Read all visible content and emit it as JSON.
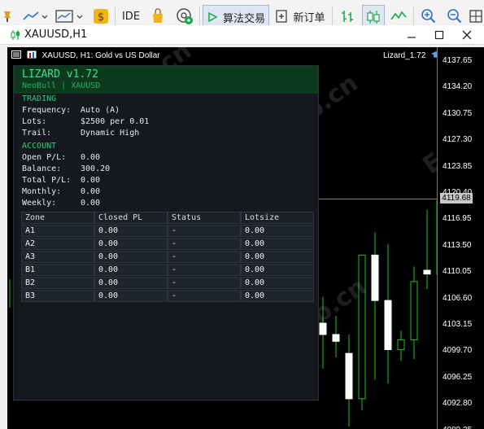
{
  "toolbar": {
    "ide_label": "IDE",
    "algo_trading_label": "算法交易",
    "new_order_label": "新订单"
  },
  "window": {
    "title": "XAUUSD,H1"
  },
  "chart": {
    "header": "XAUUSD, H1:  Gold vs US Dollar",
    "indicator_label": "Lizard_1.72",
    "current_price": "4119.68",
    "axis_ticks": [
      "4137.65",
      "4134.20",
      "4130.75",
      "4127.30",
      "4123.85",
      "4120.40",
      "4116.95",
      "4113.50",
      "4110.05",
      "4106.60",
      "4103.15",
      "4099.70",
      "4096.25",
      "4092.80",
      "4089.35"
    ]
  },
  "panel": {
    "title": "LIZARD v1.72",
    "subtitle": "NeoBull  |  XAUUSD",
    "trading_header": "TRADING",
    "trading": [
      {
        "k": "Frequency:",
        "v": "Auto (A)"
      },
      {
        "k": "Lots:",
        "v": "$2500 per 0.01"
      },
      {
        "k": "Trail:",
        "v": "Dynamic High"
      }
    ],
    "account_header": "ACCOUNT",
    "account": [
      {
        "k": "Open P/L:",
        "v": "0.00"
      },
      {
        "k": "Balance:",
        "v": "300.20"
      },
      {
        "k": "Total P/L:",
        "v": "0.00"
      },
      {
        "k": "Monthly:",
        "v": "0.00"
      },
      {
        "k": "Weekly:",
        "v": "0.00"
      }
    ],
    "table": {
      "headers": [
        "Zone",
        "Closed PL",
        "Status",
        "Lotsize"
      ],
      "rows": [
        [
          "A1",
          "0.00",
          "-",
          "0.00"
        ],
        [
          "A2",
          "0.00",
          "-",
          "0.00"
        ],
        [
          "A3",
          "0.00",
          "-",
          "0.00"
        ],
        [
          "B1",
          "0.00",
          "-",
          "0.00"
        ],
        [
          "B2",
          "0.00",
          "-",
          "0.00"
        ],
        [
          "B3",
          "0.00",
          "-",
          "0.00"
        ]
      ]
    }
  },
  "watermark": "EAHub.cn",
  "colors": {
    "bull": "#19c219",
    "panel_accent": "#3fe08a"
  },
  "candles": [
    {
      "o": 4103.0,
      "h": 4106.5,
      "l": 4097.0,
      "c": 4101.5
    },
    {
      "o": 4101.5,
      "h": 4104.0,
      "l": 4098.5,
      "c": 4100.6
    },
    {
      "o": 4099.0,
      "h": 4101.5,
      "l": 4089.3,
      "c": 4093.0
    },
    {
      "o": 4093.0,
      "h": 4112.0,
      "l": 4091.5,
      "c": 4112.0
    },
    {
      "o": 4112.0,
      "h": 4115.0,
      "l": 4095.5,
      "c": 4106.0
    },
    {
      "o": 4106.0,
      "h": 4113.5,
      "l": 4095.0,
      "c": 4099.5
    },
    {
      "o": 4099.5,
      "h": 4102.0,
      "l": 4098.0,
      "c": 4100.8
    },
    {
      "o": 4100.8,
      "h": 4110.5,
      "l": 4098.2,
      "c": 4108.5
    },
    {
      "o": 4110.0,
      "h": 4118.0,
      "l": 4107.5,
      "c": 4109.5
    },
    {
      "o": 4109.5,
      "h": 4121.0,
      "l": 4108.0,
      "c": 4119.2
    }
  ],
  "price_range": [
    4089.0,
    4139.5
  ]
}
